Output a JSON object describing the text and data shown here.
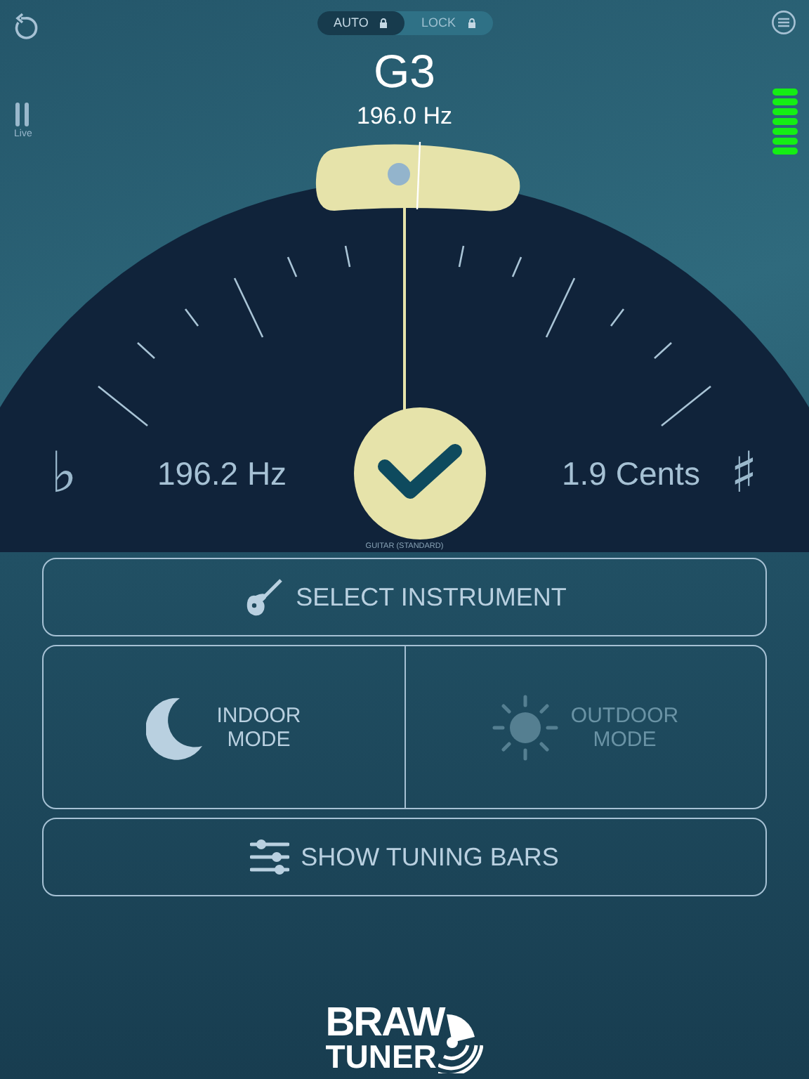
{
  "mode_toggle": [
    {
      "label": "AUTO",
      "selected": true
    },
    {
      "label": "LOCK",
      "selected": false
    }
  ],
  "note": "G3",
  "target_frequency": "196.0 Hz",
  "live_label": "Live",
  "flat_symbol": "♭",
  "sharp_symbol": "♯",
  "detected_frequency": "196.2 Hz",
  "cents": "1.9 Cents",
  "in_tune": true,
  "instrument_label": "GUITAR (STANDARD)",
  "select_instrument": {
    "label": "SELECT INSTRUMENT"
  },
  "display_modes": [
    {
      "kind": "indoor",
      "label": "INDOOR\nMODE",
      "selected": true
    },
    {
      "kind": "outdoor",
      "label": "OUTDOOR\nMODE",
      "selected": false
    }
  ],
  "tuning_bars": {
    "label": "SHOW TUNING BARS"
  },
  "logo": {
    "line_1": "BRAW",
    "line_2": "TUNER"
  }
}
